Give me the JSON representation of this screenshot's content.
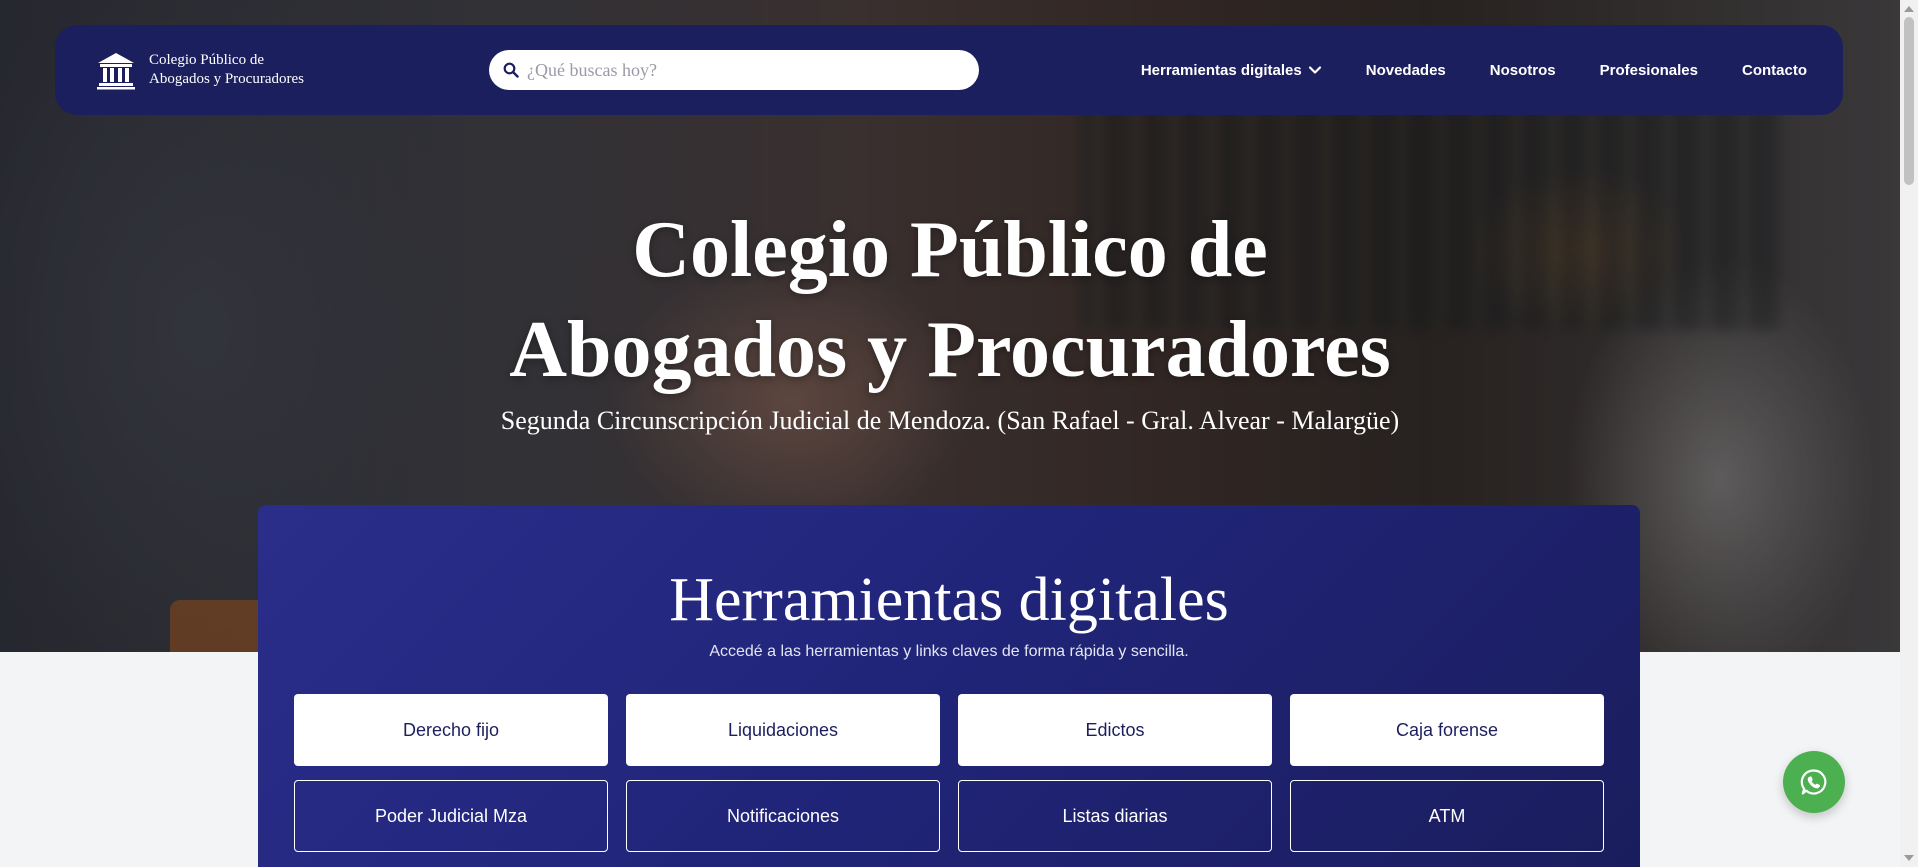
{
  "header": {
    "brand_line1": "Colegio Público de",
    "brand_line2": "Abogados y Procuradores",
    "search_placeholder": "¿Qué buscas hoy?",
    "nav": [
      {
        "label": "Herramientas digitales",
        "has_dropdown": true
      },
      {
        "label": "Novedades"
      },
      {
        "label": "Nosotros"
      },
      {
        "label": "Profesionales"
      },
      {
        "label": "Contacto"
      }
    ]
  },
  "hero": {
    "title_line1": "Colegio Público de",
    "title_line2": "Abogados y Procuradores",
    "subtitle": "Segunda Circunscripción Judicial de Mendoza. (San Rafael - Gral. Alvear - Malargüe)"
  },
  "tools": {
    "title": "Herramientas digitales",
    "subtitle": "Accedé a las herramientas y links claves de forma rápida y sencilla.",
    "primary": [
      "Derecho fijo",
      "Liquidaciones",
      "Edictos",
      "Caja forense"
    ],
    "secondary": [
      "Poder Judicial Mza",
      "Notificaciones",
      "Listas diarias",
      "ATM"
    ]
  },
  "icons": {
    "brand": "courthouse-icon",
    "search": "search-icon",
    "dropdown": "chevron-down-icon",
    "whatsapp": "whatsapp-icon"
  },
  "colors": {
    "navbar": "#1c1f5e",
    "tools_panel": "#21257a",
    "whatsapp": "#4caf50"
  }
}
